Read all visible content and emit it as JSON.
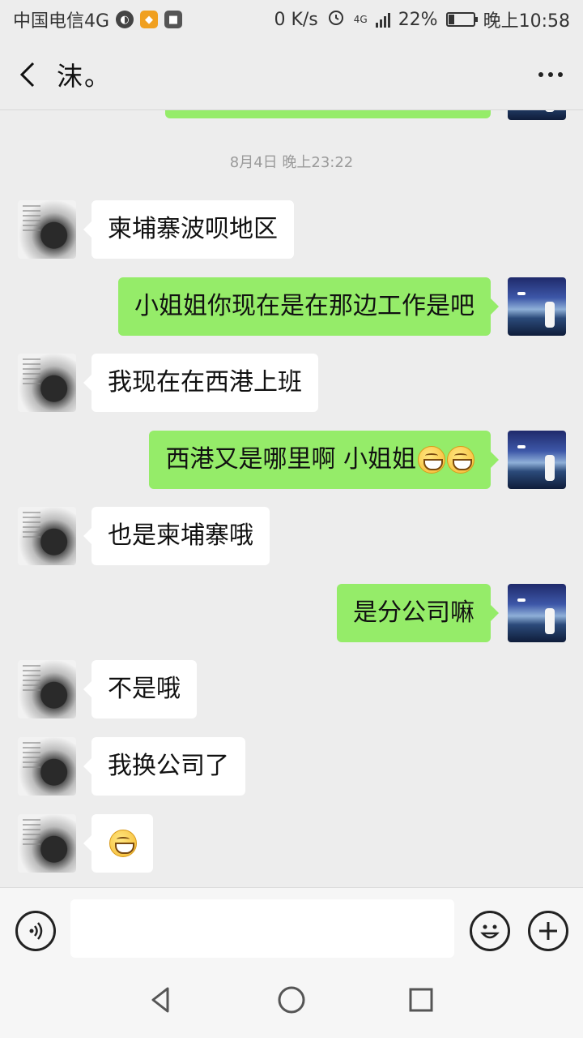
{
  "status_bar": {
    "carrier": "中国电信4G",
    "net_speed": "0 K/s",
    "network_type": "4G",
    "battery_percent": "22%",
    "battery_level": 0.22,
    "time": "晚上10:58",
    "icons": [
      "globe-icon",
      "app-notification-icon",
      "app-notification-icon",
      "alarm-icon",
      "signal-icon",
      "battery-icon"
    ]
  },
  "header": {
    "title": "沫。",
    "back_icon": "chevron-left-icon",
    "more_icon": "more-dots-icon"
  },
  "chat": {
    "timestamp": "8月4日 晚上23:22",
    "messages": [
      {
        "side": "left",
        "text": "柬埔寨波呗地区",
        "emoji_count": 0
      },
      {
        "side": "right",
        "text": "小姐姐你现在是在那边工作是吧",
        "emoji_count": 0
      },
      {
        "side": "left",
        "text": "我现在在西港上班",
        "emoji_count": 0
      },
      {
        "side": "right",
        "text": "西港又是哪里啊 小姐姐",
        "emoji_count": 2
      },
      {
        "side": "left",
        "text": "也是柬埔寨哦",
        "emoji_count": 0
      },
      {
        "side": "right",
        "text": "是分公司嘛",
        "emoji_count": 0
      },
      {
        "side": "left",
        "text": "不是哦",
        "emoji_count": 0
      },
      {
        "side": "left",
        "text": "我换公司了",
        "emoji_count": 0
      },
      {
        "side": "left",
        "text": "",
        "emoji_count": 1
      }
    ]
  },
  "colors": {
    "background": "#ededed",
    "my_bubble": "#95ec69",
    "their_bubble": "#ffffff",
    "timestamp_text": "#9a9a9a"
  },
  "input_bar": {
    "value": "",
    "placeholder": "",
    "voice_icon": "voice-icon",
    "emoji_icon": "smiley-icon",
    "plus_icon": "plus-icon"
  },
  "nav_bar": {
    "icons": [
      "nav-back-icon",
      "nav-home-icon",
      "nav-recent-icon"
    ]
  }
}
